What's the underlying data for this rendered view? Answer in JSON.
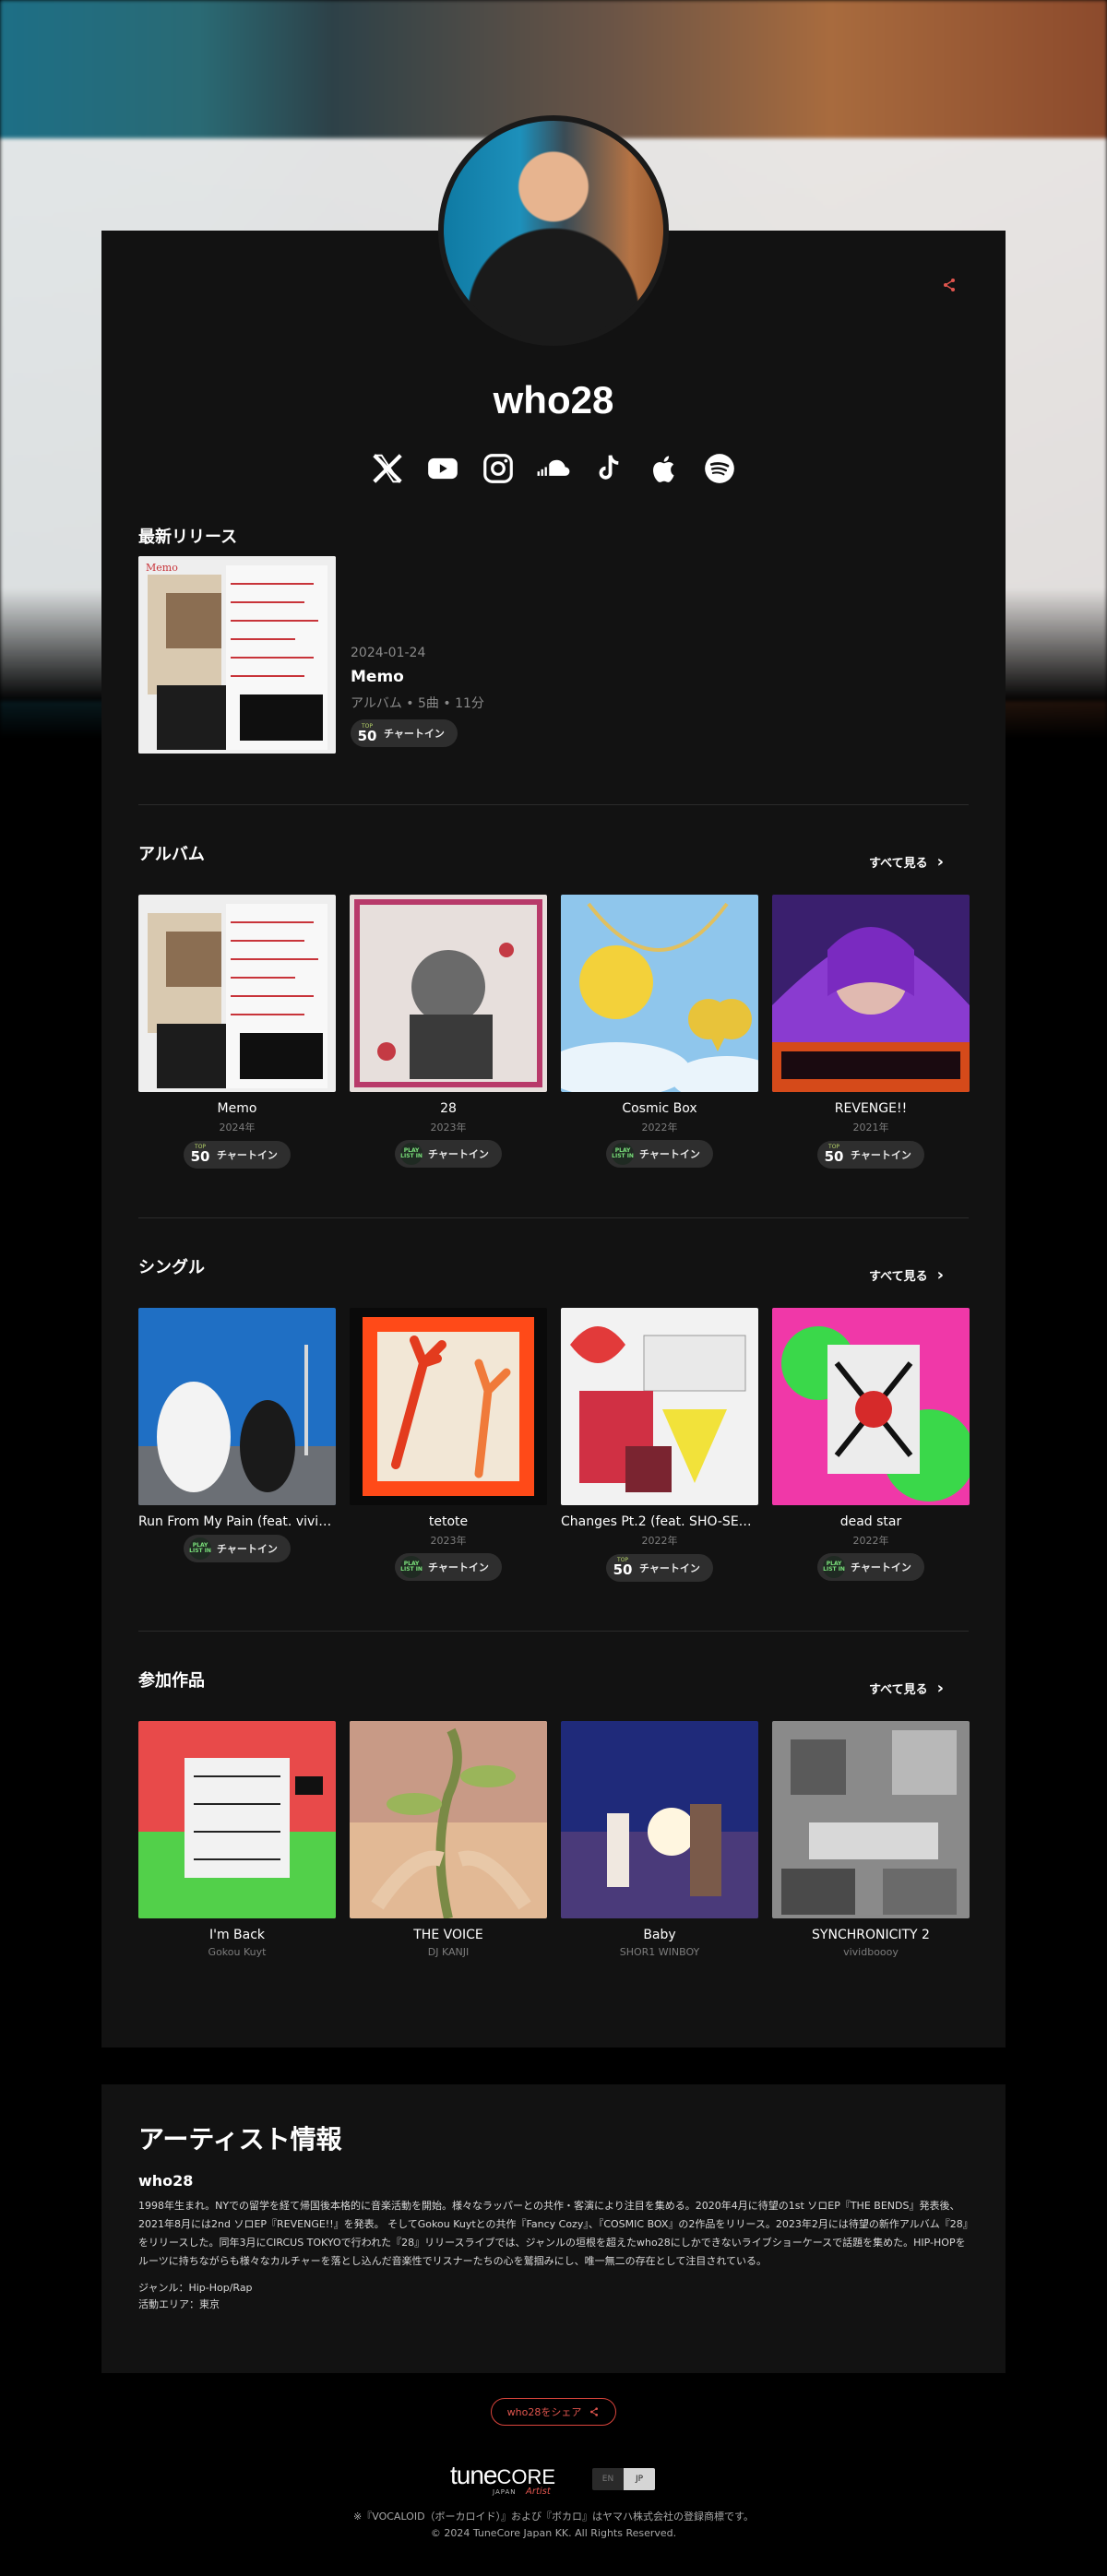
{
  "artist": {
    "name": "who28",
    "socials": [
      "x-icon",
      "youtube-icon",
      "instagram-icon",
      "soundcloud-icon",
      "tiktok-icon",
      "apple-music-icon",
      "spotify-icon"
    ]
  },
  "latest": {
    "heading": "最新リリース",
    "date": "2024-01-24",
    "title": "Memo",
    "sub": "アルバム • 5曲 • 11分",
    "badge_top": "TOP",
    "badge_num": "50",
    "chart_label": "チャートイン"
  },
  "albums": {
    "heading": "アルバム",
    "see_all": "すべて見る",
    "items": [
      {
        "title": "Memo",
        "sub": "2024年",
        "badge": "top50"
      },
      {
        "title": "28",
        "sub": "2023年",
        "badge": "playlist"
      },
      {
        "title": "Cosmic Box",
        "sub": "2022年",
        "badge": "playlist"
      },
      {
        "title": "REVENGE!!",
        "sub": "2021年",
        "badge": "top50"
      }
    ]
  },
  "singles": {
    "heading": "シングル",
    "see_all": "すべて見る",
    "items": [
      {
        "title": "Run From My Pain (feat. vividb...",
        "sub": "",
        "badge": "playlist"
      },
      {
        "title": "tetote",
        "sub": "2023年",
        "badge": "playlist"
      },
      {
        "title": "Changes Pt.2 (feat. SHO-SENSE...",
        "sub": "2022年",
        "badge": "top50"
      },
      {
        "title": "dead star",
        "sub": "2022年",
        "badge": "playlist"
      }
    ]
  },
  "features": {
    "heading": "参加作品",
    "see_all": "すべて見る",
    "items": [
      {
        "title": "I'm Back",
        "sub": "Gokou Kuyt"
      },
      {
        "title": "THE VOICE",
        "sub": "DJ KANJI"
      },
      {
        "title": "Baby",
        "sub": "SHOR1 WINBOY"
      },
      {
        "title": "SYNCHRONICITY 2",
        "sub": "vividboooy"
      }
    ]
  },
  "badges": {
    "top": "TOP",
    "num": "50",
    "playlist1": "PLAY",
    "playlist2": "LIST IN",
    "chart_label": "チャートイン"
  },
  "info": {
    "heading": "アーティスト情報",
    "name": "who28",
    "bio": "1998年生まれ。NYでの留学を経て帰国後本格的に音楽活動を開始。様々なラッパーとの共作・客演により注目を集める。2020年4月に待望の1st ソロEP『THE BENDS』発表後、2021年8月には2nd ソロEP『REVENGE!!』を発表。 そしてGokou Kuytとの共作『Fancy Cozy』、『COSMIC BOX』の2作品をリリース。2023年2月には待望の新作アルバム『28』をリリースした。同年3月にCIRCUS TOKYOで行われた『28』リリースライブでは、ジャンルの垣根を超えたwho28にしかできないライブショーケースで話題を集めた。HIP-HOPをルーツに持ちながらも様々なカルチャーを落とし込んだ音楽性でリスナーたちの心を鷲掴みにし、唯一無二の存在として注目されている。",
    "genre": "ジャンル：Hip-Hop/Rap",
    "area": "活動エリア：東京"
  },
  "footer": {
    "share_label": "who28をシェア",
    "logo_main": "tune",
    "logo_core": "CORE",
    "logo_japan": "JAPAN",
    "logo_artist": "Artist",
    "lang_en": "EN",
    "lang_jp": "JP",
    "note1": "※『VOCALOID（ボーカロイド）』および『ボカロ』はヤマハ株式会社の登録商標です。",
    "note2": "© 2024 TuneCore Japan KK. All Rights Reserved."
  },
  "colors": {
    "accent": "#e0554e",
    "card": "#121212",
    "background": "#000000"
  }
}
